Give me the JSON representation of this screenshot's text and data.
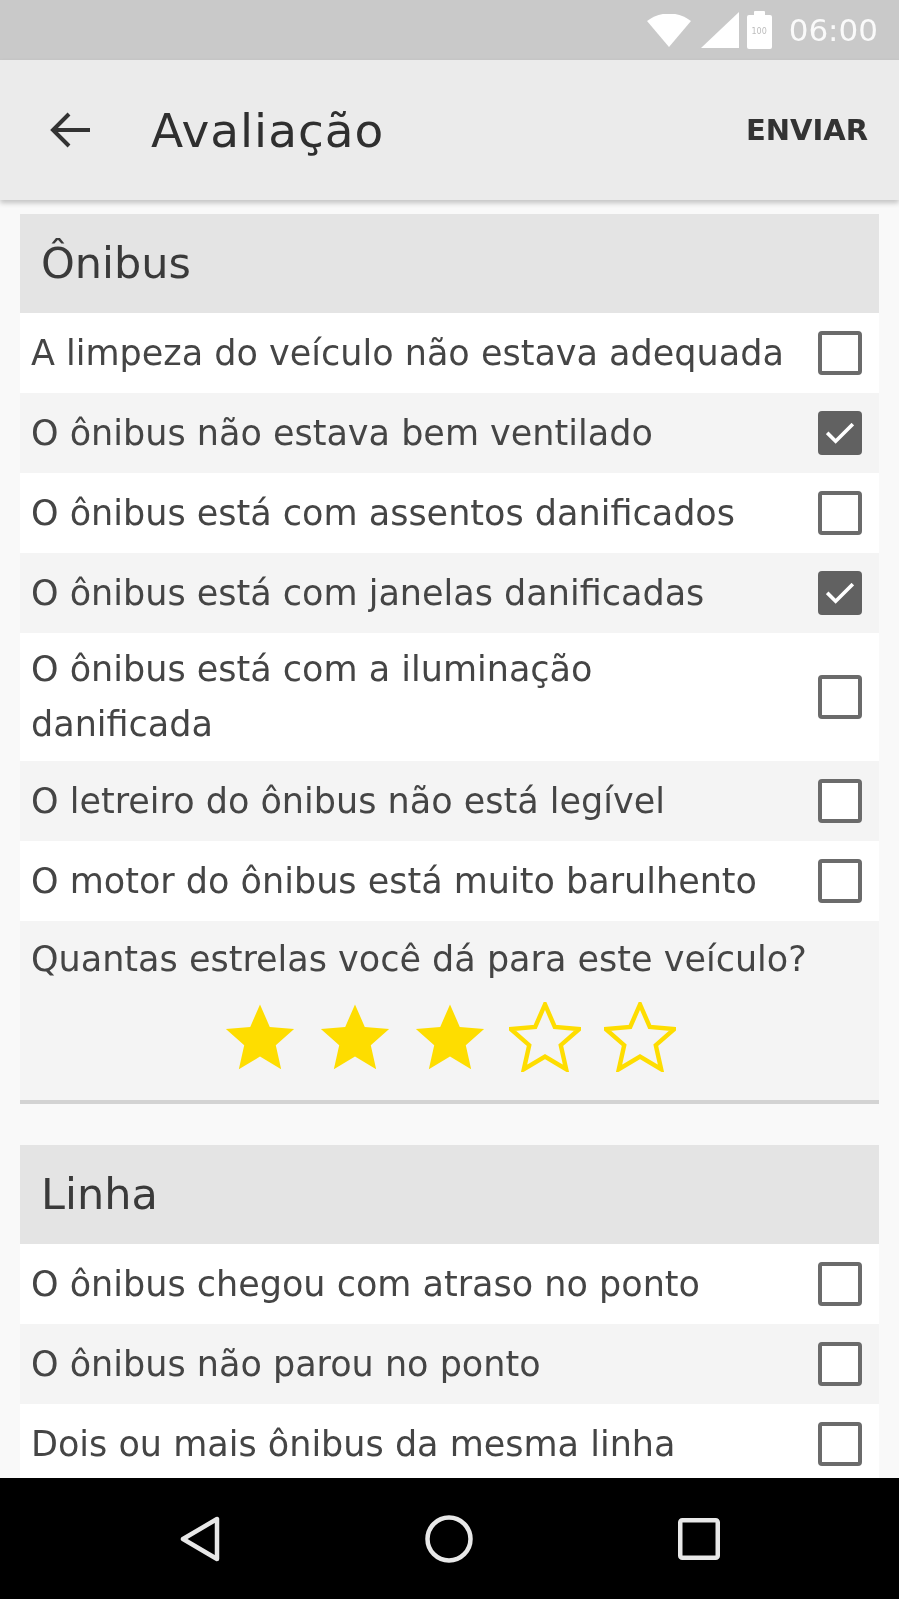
{
  "status_bar": {
    "battery": "100",
    "time": "06:00"
  },
  "app_bar": {
    "title": "Avaliação",
    "action": "ENVIAR"
  },
  "sections": [
    {
      "title": "Ônibus",
      "items": [
        {
          "label": "A limpeza do veículo não estava adequada",
          "checked": false
        },
        {
          "label": "O ônibus não estava bem ventilado",
          "checked": true
        },
        {
          "label": "O ônibus está com assentos danificados",
          "checked": false
        },
        {
          "label": "O ônibus está com janelas danificadas",
          "checked": true
        },
        {
          "label": "O ônibus está com a iluminação danificada",
          "checked": false
        },
        {
          "label": "O letreiro do ônibus não está legível",
          "checked": false
        },
        {
          "label": "O motor do ônibus está muito barulhento",
          "checked": false
        }
      ],
      "rating": {
        "question": "Quantas estrelas você dá para este veículo?",
        "stars": 3
      }
    },
    {
      "title": "Linha",
      "items": [
        {
          "label": "O ônibus chegou com atraso no ponto",
          "checked": false
        },
        {
          "label": "O ônibus não parou no ponto",
          "checked": false
        },
        {
          "label": "Dois ou mais ônibus da mesma linha",
          "checked": false
        }
      ]
    }
  ]
}
